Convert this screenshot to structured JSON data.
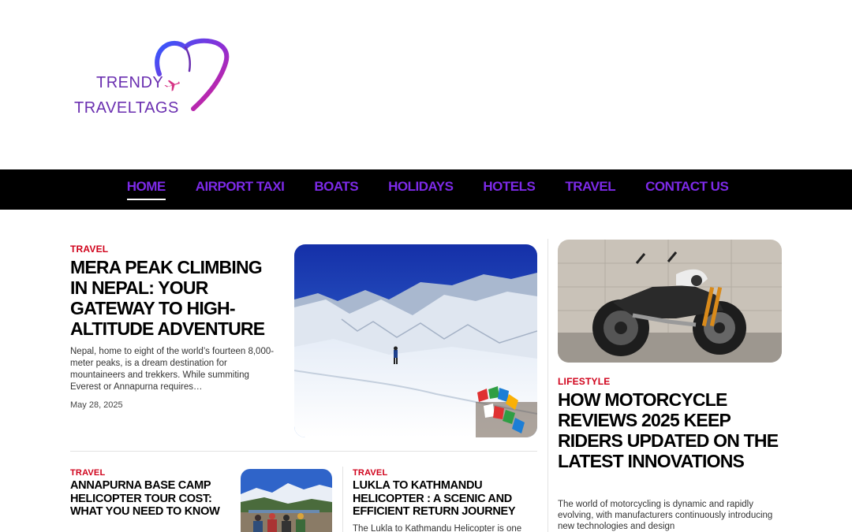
{
  "site": {
    "logo_line1": "TRENDY",
    "logo_line2": "TRAVELTAGS"
  },
  "nav": {
    "items": [
      {
        "label": "HOME",
        "active": true
      },
      {
        "label": "AIRPORT TAXI"
      },
      {
        "label": "BOATS"
      },
      {
        "label": "HOLIDAYS"
      },
      {
        "label": "HOTELS"
      },
      {
        "label": "TRAVEL"
      },
      {
        "label": "CONTACT US"
      }
    ]
  },
  "featured": {
    "category": "TRAVEL",
    "title": "MERA PEAK CLIMBING IN NEPAL: YOUR GATEWAY TO HIGH-ALTITUDE ADVENTURE",
    "excerpt": "Nepal, home to eight of the world’s fourteen 8,000-meter peaks, is a dream destination for mountaineers and trekkers. While summiting Everest or Annapurna requires…",
    "date": "May 28, 2025"
  },
  "secondary": [
    {
      "category": "TRAVEL",
      "title": "ANNAPURNA BASE CAMP HELICOPTER TOUR COST: WHAT YOU NEED TO KNOW"
    },
    {
      "category": "TRAVEL",
      "title": "LUKLA TO KATHMANDU HELICOPTER : A SCENIC AND EFFICIENT RETURN JOURNEY",
      "excerpt": "The Lukla to Kathmandu Helicopter is one"
    }
  ],
  "sidebar": {
    "category": "LIFESTYLE",
    "title": "HOW MOTORCYCLE REVIEWS 2025 KEEP RIDERS UPDATED ON THE LATEST INNOVATIONS",
    "excerpt": "The world of motorcycling is dynamic and rapidly evolving, with manufacturers continuously introducing new technologies and design"
  },
  "colors": {
    "nav_bg": "#000000",
    "nav_text": "#7d2ae8",
    "category": "#d0021b",
    "logo_text": "#6a2fb0"
  }
}
